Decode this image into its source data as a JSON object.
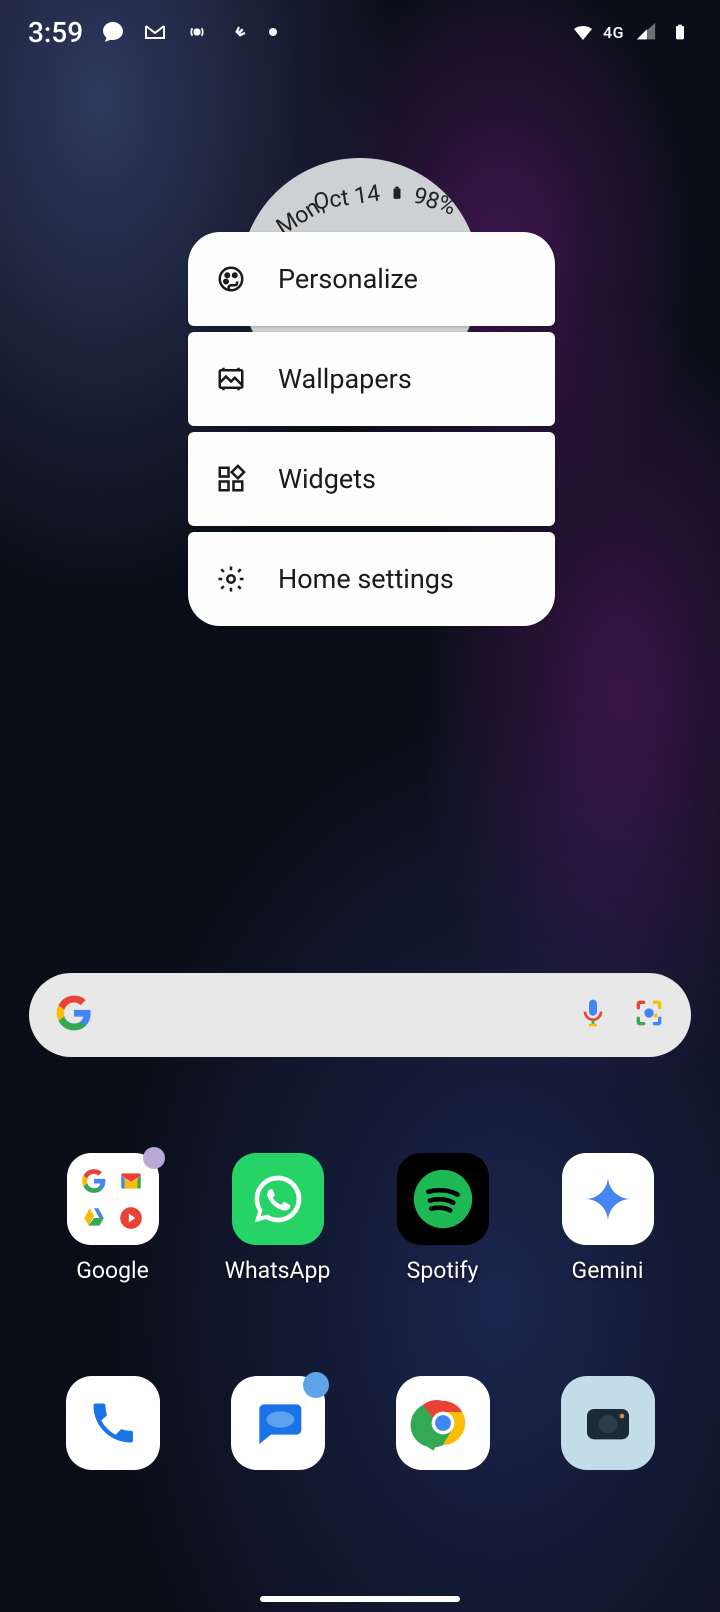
{
  "status": {
    "time": "3:59",
    "network": "4G"
  },
  "widget": {
    "date": "Mon, Oct 14",
    "battery": "98%"
  },
  "menu": {
    "items": [
      {
        "label": "Personalize"
      },
      {
        "label": "Wallpapers"
      },
      {
        "label": "Widgets"
      },
      {
        "label": "Home settings"
      }
    ]
  },
  "apps": [
    {
      "label": "Google"
    },
    {
      "label": "WhatsApp"
    },
    {
      "label": "Spotify"
    },
    {
      "label": "Gemini"
    }
  ]
}
